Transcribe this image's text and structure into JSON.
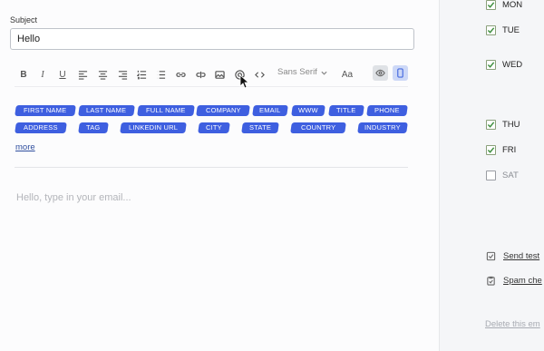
{
  "subject": {
    "label": "Subject",
    "value": "Hello"
  },
  "toolbar": {
    "bold_label": "B",
    "italic_label": "I",
    "underline_label": "U",
    "font_family": "Sans Serif",
    "text_size_label": "Aa",
    "icons": [
      "bold-icon",
      "italic-icon",
      "underline-icon",
      "align-left-icon",
      "align-center-icon",
      "align-right-icon",
      "ordered-list-icon",
      "bullet-list-icon",
      "link-icon",
      "unlink-icon",
      "image-icon",
      "at-sign-icon",
      "code-icon",
      "chevron-down-icon",
      "eye-icon",
      "mobile-view-icon"
    ]
  },
  "tags": [
    "FIRST NAME",
    "LAST NAME",
    "FULL NAME",
    "COMPANY",
    "EMAIL",
    "WWW",
    "TITLE",
    "PHONE",
    "ADDRESS",
    "TAG",
    "LINKEDIN URL",
    "CITY",
    "STATE",
    "COUNTRY",
    "INDUSTRY"
  ],
  "more_label": "more",
  "body": {
    "placeholder": "Hello, type in your email..."
  },
  "schedule": {
    "days": [
      {
        "label": "MON",
        "checked": true
      },
      {
        "label": "TUE",
        "checked": true
      },
      {
        "label": "WED",
        "checked": true
      },
      {
        "label": "THU",
        "checked": true
      },
      {
        "label": "FRI",
        "checked": true
      },
      {
        "label": "SAT",
        "checked": false
      }
    ]
  },
  "actions": {
    "send_test": "Send test",
    "spam_check": "Spam che",
    "delete": "Delete this em"
  },
  "colors": {
    "tag_bg": "#3e5fe0",
    "link": "#2f4e9e",
    "check": "#3f8f3f"
  }
}
